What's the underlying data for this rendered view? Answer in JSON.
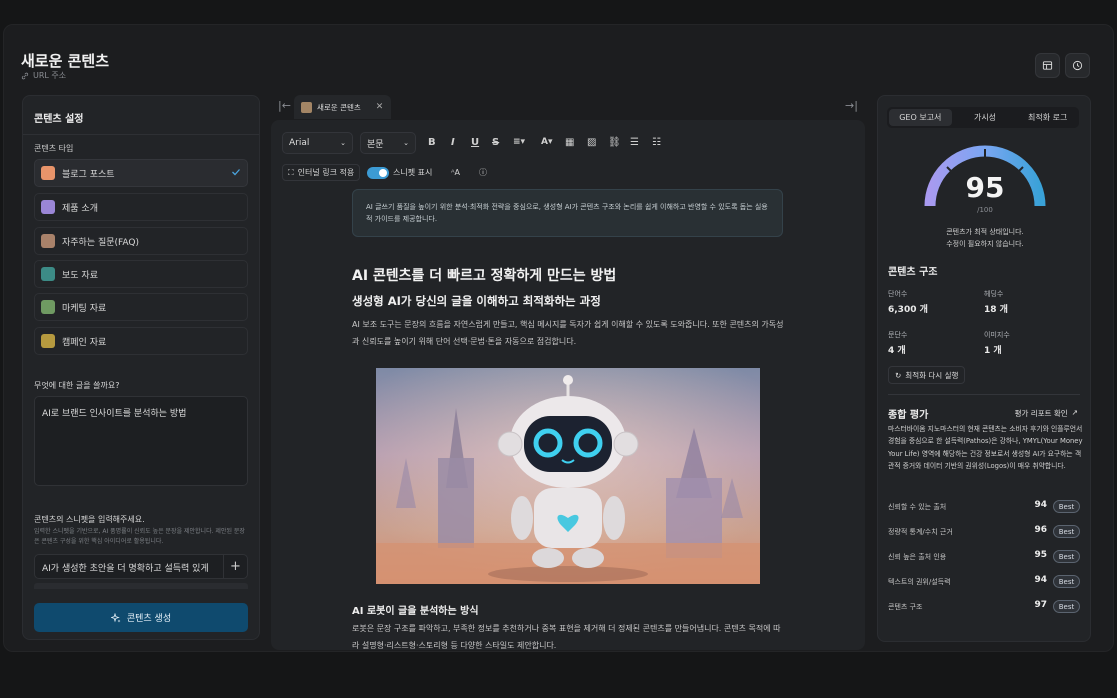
{
  "header": {
    "title": "새로운 콘텐츠",
    "url_label": "URL 주소"
  },
  "left": {
    "title": "콘텐츠 설정",
    "type_label": "콘텐츠 타입",
    "types": [
      {
        "label": "블로그 포스트",
        "color": "#e8946a",
        "selected": true
      },
      {
        "label": "제품 소개",
        "color": "#9a86d6"
      },
      {
        "label": "자주하는 질문(FAQ)",
        "color": "#a9826a"
      },
      {
        "label": "보도 자료",
        "color": "#3c8b86"
      },
      {
        "label": "마케팅 자료",
        "color": "#6f9a62"
      },
      {
        "label": "캠페인 자료",
        "color": "#b69a3f"
      }
    ],
    "question_label": "무엇에 대한 글을 쓸까요?",
    "question_value": "AI로 브랜드 인사이트를 분석하는 방법",
    "snippet_label": "콘텐츠의 스니펫을 입력해주세요.",
    "snippet_help": "입력한 스니펫을 기반으로, AI 품명률이 신뢰도 높은 문장을 제안합니다. 제안된 문장은 콘텐츠 구성을 위한 핵심 아이디어로 활용됩니다.",
    "snippet_value": "AI가 생성한 초안을 더 명확하고 설득력 있게",
    "generate_label": "콘텐츠 생성"
  },
  "editor": {
    "tab_label": "새로운 콘텐츠",
    "font": "Arial",
    "style": "본문",
    "internal_link": "인터널 링크 적용",
    "snippet_toggle": "스니펫 표시",
    "info": "AI 글쓰기 품질을 높이기 위한 분석·최적화 전략을 중심으로, 생성형 AI가 콘텐츠 구조와 논리를 쉽게 이해하고 반영할 수 있도록 돕는 실용적 가이드를 제공합니다.",
    "h1": "AI 콘텐츠를 더 빠르고 정확하게 만드는 방법",
    "h2": "생성형 AI가 당신의 글을 이해하고 최적화하는 과정",
    "p1": "AI 보조 도구는 문장의 흐름을 자연스럽게 만들고, 핵심 메시지를 독자가 쉽게 이해할 수 있도록 도와줍니다. 또한 콘텐츠의 가독성과 신뢰도를 높이기 위해 단어 선택·문법·톤을 자동으로 점검합니다.",
    "h3": "AI 로봇이 글을 분석하는 방식",
    "p2": "로봇은 문장 구조를 파악하고, 부족한 정보를 추천하거나 중복 표현을 제거해 더 정제된 콘텐츠를 만들어냅니다. 콘텐츠 목적에 따라 설명형·리스트형·스토리형 등 다양한 스타일도 제안합니다."
  },
  "right": {
    "tabs": [
      "GEO 보고서",
      "가시성",
      "최적화 로그"
    ],
    "score": "95",
    "score_max": "/100",
    "score_msg1": "콘텐츠가 최적 상태입니다.",
    "score_msg2": "수정이 필요하지 않습니다.",
    "structure_title": "콘텐츠 구조",
    "stats": [
      {
        "label": "단어수",
        "value": "6,300 개"
      },
      {
        "label": "헤딩수",
        "value": "18 개"
      },
      {
        "label": "문단수",
        "value": "4 개"
      },
      {
        "label": "이미지수",
        "value": "1 개"
      }
    ],
    "reopt_label": "최적화 다시 실행",
    "eval_title": "종합 평가",
    "report_link": "평가 리포트 확인",
    "summary": "마스터바이옴 지노마스터의 현재 콘텐츠는 소비자 후기와 인플루언서 경험을 중심으로 한 설득력(Pathos)은 강하나, YMYL(Your Money Your Life) 영역에 해당하는 건강 정보로서 생성형 AI가 요구하는 객관적 증거와 데이터 기반의 권위성(Logos)이 매우 취약합니다.",
    "metrics": [
      {
        "label": "신뢰할 수 있는 출처",
        "value": "94",
        "badge": "Best"
      },
      {
        "label": "정량적 통계/수치 근거",
        "value": "96",
        "badge": "Best"
      },
      {
        "label": "신뢰 높은 출처 인용",
        "value": "95",
        "badge": "Best"
      },
      {
        "label": "텍스트의 권위/설득력",
        "value": "94",
        "badge": "Best"
      },
      {
        "label": "콘텐츠 구조",
        "value": "97",
        "badge": "Best"
      }
    ]
  }
}
